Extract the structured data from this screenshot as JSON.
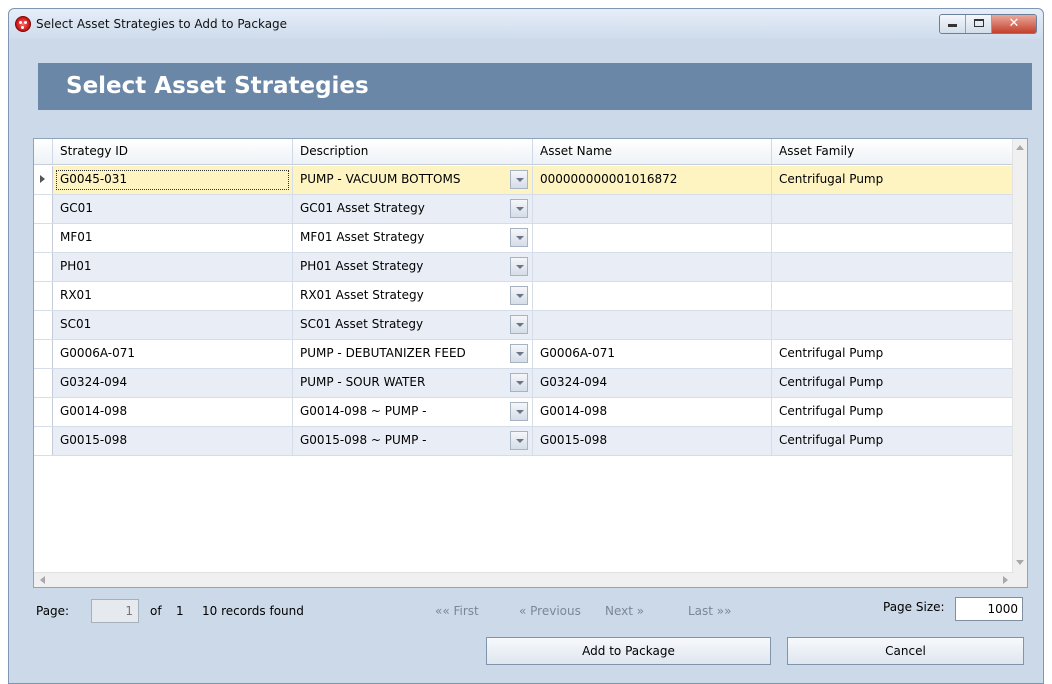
{
  "window": {
    "title": "Select Asset Strategies to Add to Package",
    "close_glyph": "✕"
  },
  "header": {
    "title": "Select Asset Strategies"
  },
  "grid": {
    "columns": [
      "Strategy ID",
      "Description",
      "Asset Name",
      "Asset Family"
    ],
    "rows": [
      {
        "strategy_id": "G0045-031",
        "description": "PUMP - VACUUM BOTTOMS",
        "asset_name": "000000000001016872",
        "asset_family": "Centrifugal Pump"
      },
      {
        "strategy_id": "GC01",
        "description": "GC01 Asset Strategy",
        "asset_name": "",
        "asset_family": ""
      },
      {
        "strategy_id": "MF01",
        "description": "MF01 Asset Strategy",
        "asset_name": "",
        "asset_family": ""
      },
      {
        "strategy_id": "PH01",
        "description": "PH01 Asset Strategy",
        "asset_name": "",
        "asset_family": ""
      },
      {
        "strategy_id": "RX01",
        "description": "RX01 Asset Strategy",
        "asset_name": "",
        "asset_family": ""
      },
      {
        "strategy_id": "SC01",
        "description": "SC01 Asset Strategy",
        "asset_name": "",
        "asset_family": ""
      },
      {
        "strategy_id": "G0006A-071",
        "description": "PUMP - DEBUTANIZER FEED",
        "asset_name": "G0006A-071",
        "asset_family": "Centrifugal Pump"
      },
      {
        "strategy_id": "G0324-094",
        "description": "PUMP - SOUR WATER",
        "asset_name": "G0324-094",
        "asset_family": "Centrifugal Pump"
      },
      {
        "strategy_id": "G0014-098",
        "description": "G0014-098 ~ PUMP -",
        "asset_name": "G0014-098",
        "asset_family": "Centrifugal Pump"
      },
      {
        "strategy_id": "G0015-098",
        "description": "G0015-098 ~ PUMP -",
        "asset_name": "G0015-098",
        "asset_family": "Centrifugal Pump"
      }
    ]
  },
  "pager": {
    "page_label": "Page:",
    "page_value": "1",
    "of_label": "of",
    "total_pages": "1",
    "records_found": "10 records found",
    "first": "«« First",
    "previous": "« Previous",
    "next": "Next »",
    "last": "Last »»",
    "page_size_label": "Page Size:",
    "page_size_value": "1000"
  },
  "actions": {
    "add_label": "Add to Package",
    "cancel_label": "Cancel"
  }
}
